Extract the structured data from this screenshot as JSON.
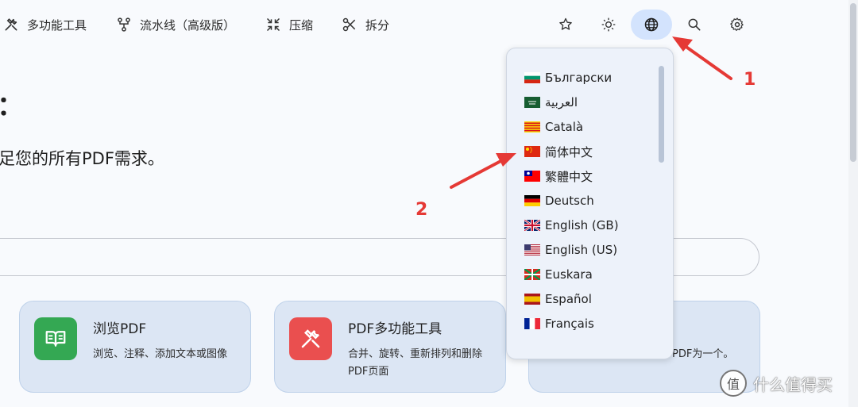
{
  "nav": {
    "items": [
      {
        "label": "多功能工具",
        "icon": "tools-icon"
      },
      {
        "label": "流水线（高级版）",
        "icon": "pipeline-icon"
      },
      {
        "label": "压缩",
        "icon": "compress-icon"
      },
      {
        "label": "拆分",
        "icon": "scissors-icon"
      }
    ],
    "right_icons": [
      "star-icon",
      "sun-icon",
      "globe-icon",
      "search-icon",
      "gear-icon"
    ],
    "active_icon": "globe-icon",
    "active_color": "#d3e3fd"
  },
  "main": {
    "heading_fragment": "：",
    "subtitle": "足您的所有PDF需求。",
    "search_placeholder": ""
  },
  "cards": [
    {
      "title": "浏览PDF",
      "desc": "浏览、注释、添加文本或图像",
      "icon": "book-icon",
      "icon_color": "#34a853"
    },
    {
      "title": "PDF多功能工具",
      "desc": "合并、旋转、重新排列和删除PDF页面",
      "icon": "tools-icon",
      "icon_color": "#ea4f4f"
    },
    {
      "title": "",
      "desc": "PDF为一个。",
      "icon": "",
      "icon_color": ""
    }
  ],
  "language_menu": {
    "items": [
      {
        "label": "Български",
        "flag": "bg"
      },
      {
        "label": "العربية",
        "flag": "sa"
      },
      {
        "label": "Català",
        "flag": "ca"
      },
      {
        "label": "简体中文",
        "flag": "cn"
      },
      {
        "label": "繁體中文",
        "flag": "tw"
      },
      {
        "label": "Deutsch",
        "flag": "de"
      },
      {
        "label": "English (GB)",
        "flag": "gb"
      },
      {
        "label": "English (US)",
        "flag": "us"
      },
      {
        "label": "Euskara",
        "flag": "eus"
      },
      {
        "label": "Español",
        "flag": "es"
      },
      {
        "label": "Français",
        "flag": "fr"
      }
    ]
  },
  "annotations": {
    "one": "1",
    "two": "2",
    "color": "#e53935"
  },
  "watermark": {
    "text": "什么值得买",
    "badge": "值"
  }
}
